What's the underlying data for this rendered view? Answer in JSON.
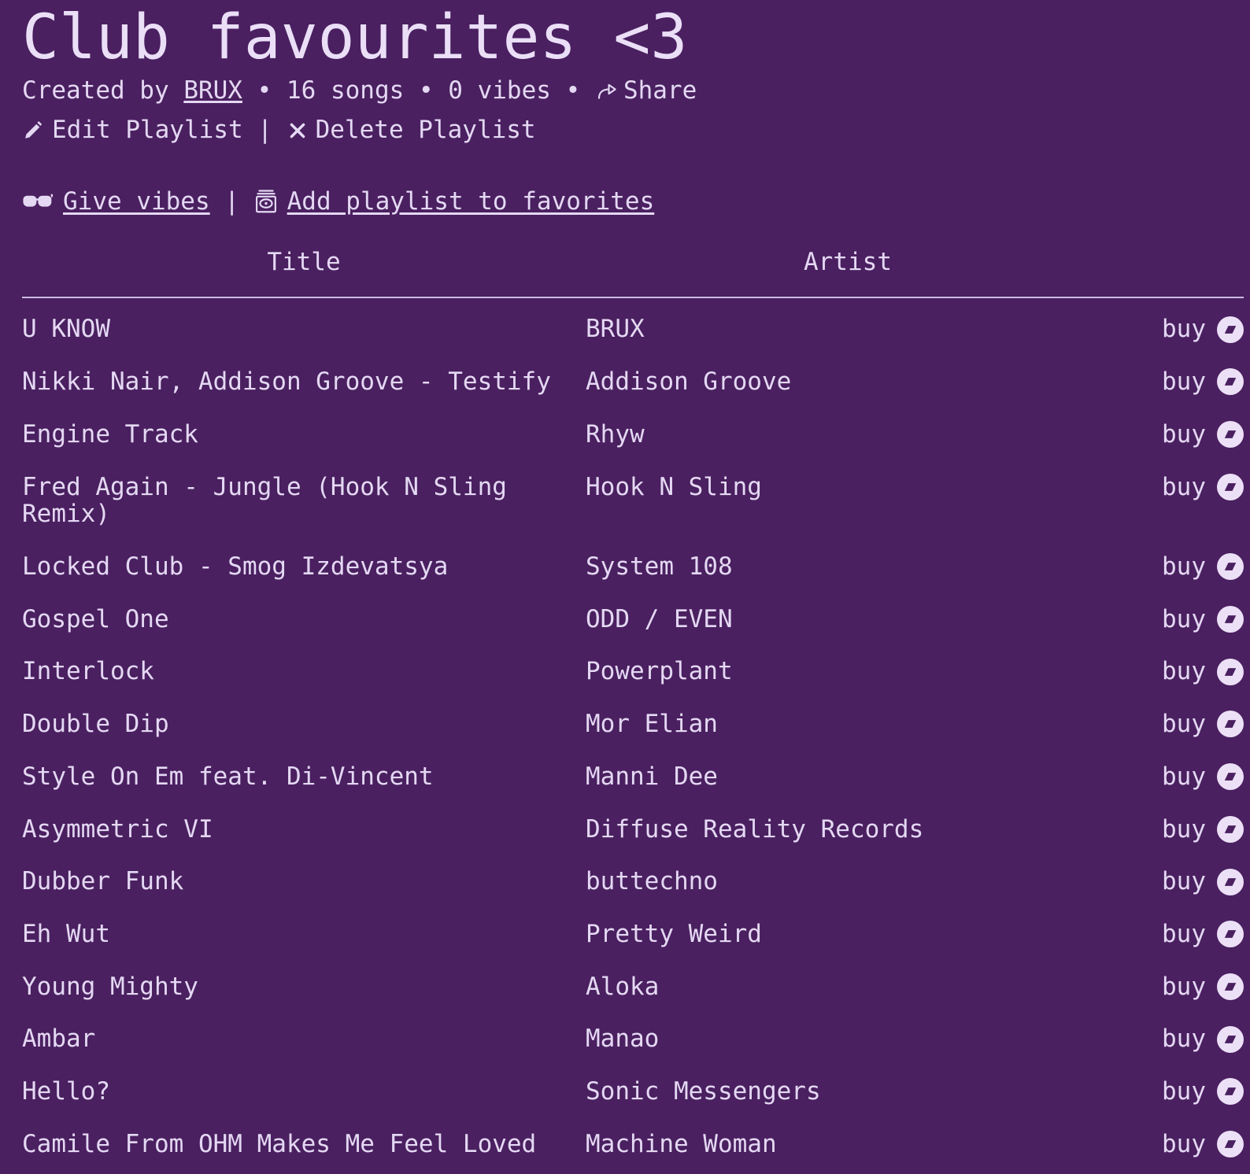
{
  "playlist": {
    "title": "Club favourites <3",
    "created_by_prefix": "Created by ",
    "author": "BRUX",
    "sep1": " • ",
    "song_count": "16 songs",
    "sep2": " • ",
    "vibe_count": "0 vibes",
    "sep3": " • ",
    "share_label": "Share",
    "share_icon": "share-arrow-icon"
  },
  "actions": {
    "edit_icon": "pencil-icon",
    "edit_label": "Edit Playlist",
    "divider": " | ",
    "delete_icon": "x-mark-icon",
    "delete_label": "Delete Playlist"
  },
  "vibes": {
    "glasses_icon": "glasses-icon",
    "give_vibes_label": "Give vibes",
    "divider": " | ",
    "cassette_icon": "card-file-box-icon",
    "add_favorites_label": "Add playlist to favorites"
  },
  "table": {
    "columns": {
      "title": "Title",
      "artist": "Artist",
      "buy": ""
    },
    "buy_label": "buy",
    "buy_icon": "bandcamp-logo-icon",
    "rows": [
      {
        "title": "U KNOW",
        "artist": "BRUX"
      },
      {
        "title": "Nikki Nair, Addison Groove - Testify",
        "artist": "Addison Groove"
      },
      {
        "title": "Engine Track",
        "artist": "Rhyw"
      },
      {
        "title": "Fred Again - Jungle (Hook N Sling Remix)",
        "artist": "Hook N Sling"
      },
      {
        "title": "Locked Club - Smog Izdevatsya",
        "artist": "System 108"
      },
      {
        "title": "Gospel One",
        "artist": "ODD / EVEN"
      },
      {
        "title": "Interlock",
        "artist": "Powerplant"
      },
      {
        "title": "Double Dip",
        "artist": "Mor Elian"
      },
      {
        "title": "Style On Em feat. Di-Vincent",
        "artist": "Manni Dee"
      },
      {
        "title": "Asymmetric VI",
        "artist": "Diffuse Reality Records"
      },
      {
        "title": "Dubber Funk",
        "artist": "buttechno"
      },
      {
        "title": "Eh Wut",
        "artist": "Pretty Weird"
      },
      {
        "title": "Young Mighty",
        "artist": "Aloka"
      },
      {
        "title": "Ambar",
        "artist": "Manao"
      },
      {
        "title": "Hello?",
        "artist": "Sonic Messengers"
      },
      {
        "title": "Camile From OHM Makes Me Feel Loved",
        "artist": "Machine Woman"
      }
    ]
  },
  "colors": {
    "background": "#4a2060",
    "text": "#e4d8f3",
    "title_text": "#eadff7",
    "rule": "#cdbbe2"
  }
}
